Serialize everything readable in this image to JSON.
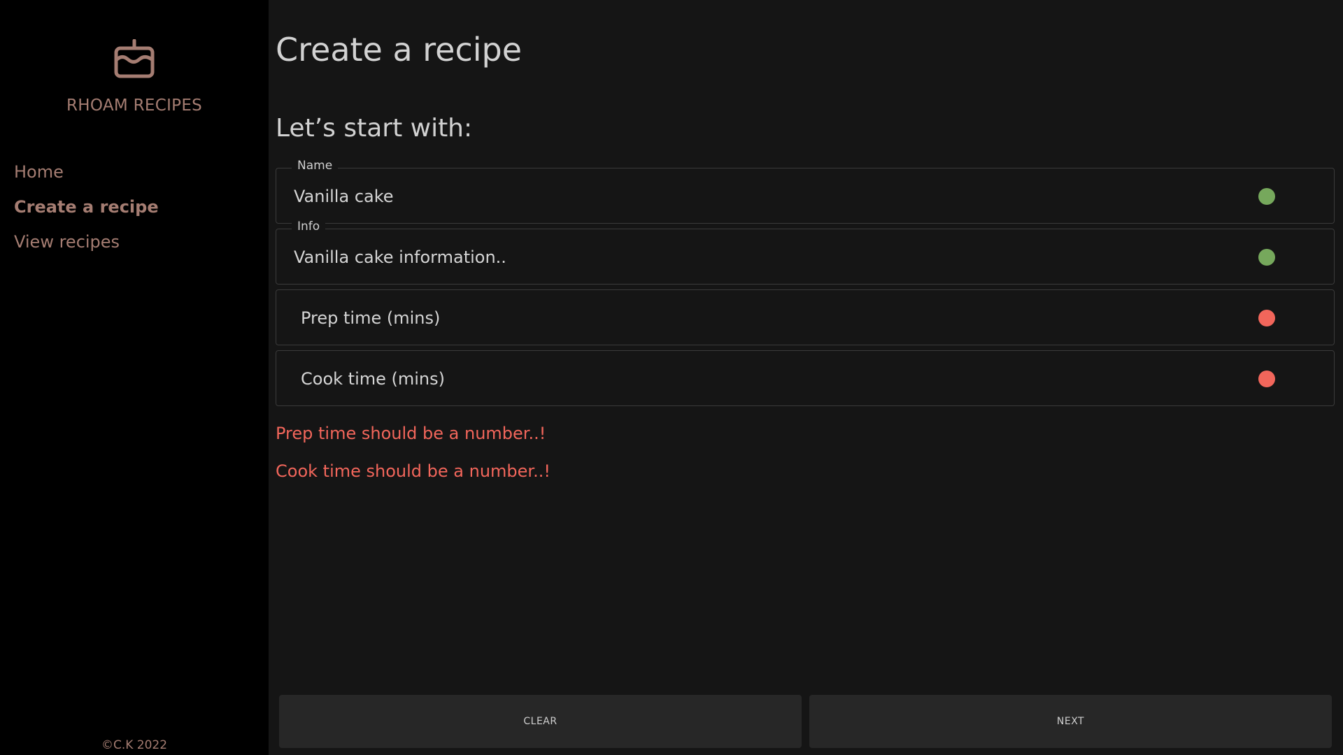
{
  "sidebar": {
    "brand_icon": "cake-icon",
    "brand_name": "RHOAM RECIPES",
    "nav": [
      {
        "label": "Home"
      },
      {
        "label": "Create a recipe"
      },
      {
        "label": "View recipes"
      }
    ],
    "copyright": "©C.K 2022"
  },
  "main": {
    "title": "Create a recipe",
    "subtitle": "Let’s start with:",
    "fields": [
      {
        "legend": "Name",
        "value": "Vanilla cake",
        "status": "valid"
      },
      {
        "legend": "Info",
        "value": "Vanilla cake information..",
        "status": "valid"
      },
      {
        "placeholder": "Prep time (mins)",
        "status": "invalid"
      },
      {
        "placeholder": "Cook time (mins)",
        "status": "invalid"
      }
    ],
    "errors": [
      "Prep time should be a number..!",
      "Cook time should be a number..!"
    ],
    "buttons": {
      "clear": "CLEAR",
      "next": "NEXT"
    }
  },
  "colors": {
    "accent": "#a57d72",
    "valid": "#76a85c",
    "invalid": "#f2665b",
    "background": "#151515",
    "sidebar": "#000000"
  }
}
